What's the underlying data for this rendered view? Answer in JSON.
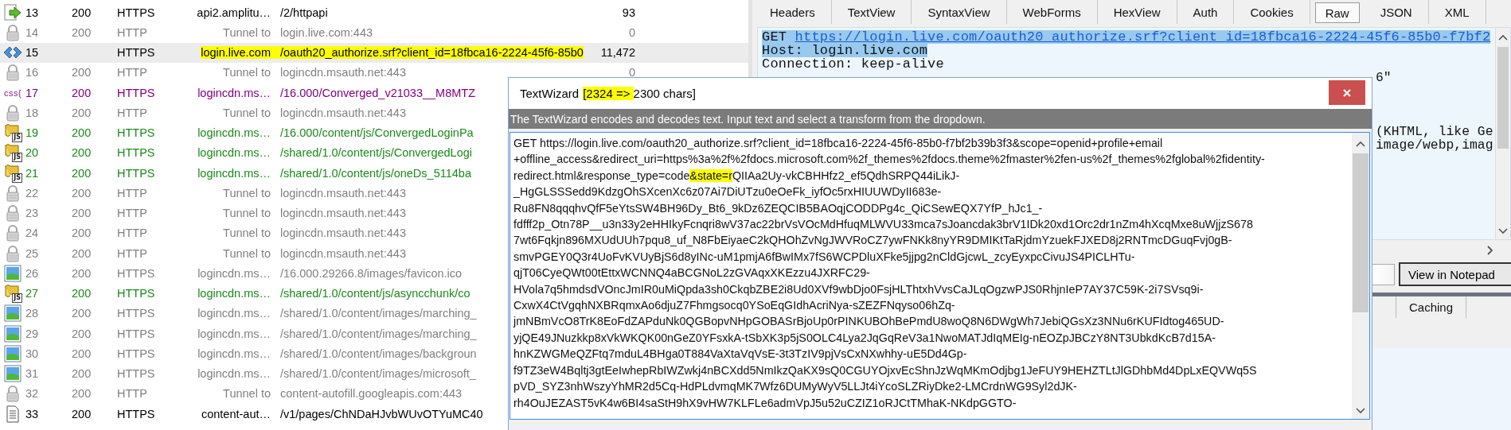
{
  "sessions": {
    "rows": [
      {
        "kind": "arrow",
        "number": "13",
        "result": "200",
        "protocol": "HTTPS",
        "host": "api2.amplitu…",
        "url": "/2/httpapi",
        "body": "93",
        "color": "#000000",
        "selected": false,
        "marked": false
      },
      {
        "kind": "lock",
        "number": "14",
        "result": "200",
        "protocol": "HTTP",
        "host": "Tunnel to",
        "url": "login.live.com:443",
        "body": "0",
        "color": "#808080",
        "selected": false,
        "marked": false
      },
      {
        "kind": "code",
        "number": "15",
        "protocol": "HTTPS",
        "host": "login.live.com",
        "url": "/oauth20_authorize.srf?client_id=18fbca16-2224-45f6-85b0",
        "body": "11,472",
        "color": "#000000",
        "selected": true,
        "marked": true
      },
      {
        "kind": "lock",
        "number": "16",
        "result": "200",
        "protocol": "HTTP",
        "host": "Tunnel to",
        "url": "logincdn.msauth.net:443",
        "body": "0",
        "color": "#808080",
        "selected": false,
        "marked": false
      },
      {
        "kind": "css",
        "icon_text": "css{",
        "number": "17",
        "result": "200",
        "protocol": "HTTPS",
        "host": "logincdn.ms…",
        "url": "/16.000/Converged_v21033__M8MTZ",
        "color": "#800080",
        "selected": false,
        "marked": false
      },
      {
        "kind": "lock",
        "number": "18",
        "result": "200",
        "protocol": "HTTP",
        "host": "Tunnel to",
        "url": "logincdn.msauth.net:443",
        "color": "#808080",
        "selected": false,
        "marked": false
      },
      {
        "kind": "js",
        "icon_text": "JS",
        "number": "19",
        "result": "200",
        "protocol": "HTTPS",
        "host": "logincdn.ms…",
        "url": "/16.000/content/js/ConvergedLoginPa",
        "color": "#1a8a1a",
        "selected": false,
        "marked": false
      },
      {
        "kind": "js",
        "icon_text": "JS",
        "number": "20",
        "result": "200",
        "protocol": "HTTPS",
        "host": "logincdn.ms…",
        "url": "/shared/1.0/content/js/ConvergedLogi",
        "color": "#1a8a1a",
        "selected": false,
        "marked": false
      },
      {
        "kind": "js",
        "icon_text": "JS",
        "number": "21",
        "result": "200",
        "protocol": "HTTPS",
        "host": "logincdn.ms…",
        "url": "/shared/1.0/content/js/oneDs_5114ba",
        "color": "#1a8a1a",
        "selected": false,
        "marked": false
      },
      {
        "kind": "lock",
        "number": "22",
        "result": "200",
        "protocol": "HTTP",
        "host": "Tunnel to",
        "url": "logincdn.msauth.net:443",
        "color": "#808080",
        "selected": false,
        "marked": false
      },
      {
        "kind": "lock",
        "number": "23",
        "result": "200",
        "protocol": "HTTP",
        "host": "Tunnel to",
        "url": "logincdn.msauth.net:443",
        "color": "#808080",
        "selected": false,
        "marked": false
      },
      {
        "kind": "lock",
        "number": "24",
        "result": "200",
        "protocol": "HTTP",
        "host": "Tunnel to",
        "url": "logincdn.msauth.net:443",
        "color": "#808080",
        "selected": false,
        "marked": false
      },
      {
        "kind": "lock",
        "number": "25",
        "result": "200",
        "protocol": "HTTP",
        "host": "Tunnel to",
        "url": "logincdn.msauth.net:443",
        "color": "#808080",
        "selected": false,
        "marked": false
      },
      {
        "kind": "image",
        "number": "26",
        "result": "200",
        "protocol": "HTTPS",
        "host": "logincdn.ms…",
        "url": "/16.000.29266.8/images/favicon.ico",
        "color": "#808080",
        "selected": false,
        "marked": false
      },
      {
        "kind": "js",
        "icon_text": "JS",
        "number": "27",
        "result": "200",
        "protocol": "HTTPS",
        "host": "logincdn.ms…",
        "url": "/shared/1.0/content/js/asyncchunk/co",
        "color": "#1a8a1a",
        "selected": false,
        "marked": false
      },
      {
        "kind": "image",
        "number": "28",
        "result": "200",
        "protocol": "HTTPS",
        "host": "logincdn.ms…",
        "url": "/shared/1.0/content/images/marching_",
        "color": "#808080",
        "selected": false,
        "marked": false
      },
      {
        "kind": "image",
        "number": "29",
        "result": "200",
        "protocol": "HTTPS",
        "host": "logincdn.ms…",
        "url": "/shared/1.0/content/images/marching_",
        "color": "#808080",
        "selected": false,
        "marked": false
      },
      {
        "kind": "image",
        "number": "30",
        "result": "200",
        "protocol": "HTTPS",
        "host": "logincdn.ms…",
        "url": "/shared/1.0/content/images/backgroun",
        "color": "#808080",
        "selected": false,
        "marked": false
      },
      {
        "kind": "image",
        "number": "31",
        "result": "200",
        "protocol": "HTTPS",
        "host": "logincdn.ms…",
        "url": "/shared/1.0/content/images/microsoft_",
        "color": "#808080",
        "selected": false,
        "marked": false
      },
      {
        "kind": "lock",
        "number": "32",
        "result": "200",
        "protocol": "HTTP",
        "host": "Tunnel to",
        "url": "content-autofill.googleapis.com:443",
        "color": "#808080",
        "selected": false,
        "marked": false
      },
      {
        "kind": "doc",
        "number": "33",
        "result": "200",
        "protocol": "HTTPS",
        "host": "content-aut…",
        "url": "/v1/pages/ChNDaHJvbWUvOTYuMC40",
        "color": "#000000",
        "selected": false,
        "marked": false
      }
    ]
  },
  "inspector": {
    "tabs": [
      {
        "label": "Headers",
        "selected": false
      },
      {
        "label": "TextView",
        "selected": false
      },
      {
        "label": "SyntaxView",
        "selected": false
      },
      {
        "label": "WebForms",
        "selected": false
      },
      {
        "label": "HexView",
        "selected": false
      },
      {
        "label": "Auth",
        "selected": false
      },
      {
        "label": "Cookies",
        "selected": false
      },
      {
        "label": "Raw",
        "selected": true
      },
      {
        "label": "JSON",
        "selected": false
      },
      {
        "label": "XML",
        "selected": false
      }
    ],
    "raw": {
      "lines": [
        {
          "text": "GET",
          "link": "https://login.live.com/oauth20_authorize.srf?client_id=18fbca16-2224-45f6-85b0-f7bf2",
          "selected": true
        },
        {
          "text": "Host: login.live.com",
          "selected": true
        },
        {
          "text": "Connection: keep-alive",
          "selected": false
        }
      ],
      "tails": [
        "6\"",
        "(KHTML, like Ge",
        "image/webp,imag"
      ]
    },
    "notepad_button": "View in Notepad",
    "lower_tabs": [
      {
        "label": "Caching",
        "selected": false
      }
    ]
  },
  "text_wizard": {
    "title": "TextWizard",
    "count": "[2324 => 2300 chars]",
    "description": "The TextWizard encodes and decodes text. Input text and select a transform from the dropdown.",
    "lines": [
      [
        {
          "text": "GET https://login.live.com/oauth20_authorize.srf?client_id=18fbca16-2224-45f6-85b0-f7bf2b39b3f3&scope=openid+profile+email",
          "highlighted": false
        }
      ],
      [
        {
          "text": "+offline_access&redirect_uri=https%3a%2f%2fdocs.microsoft.com%2f_themes%2fdocs.theme%2fmaster%2fen-us%2f_themes%2fglobal%2fidentity-",
          "highlighted": false
        }
      ],
      [
        {
          "text": "redirect.html&response_type=code",
          "highlighted": false
        },
        {
          "text": "&state=r",
          "highlighted": true
        },
        {
          "text": "QIIAa2Uy-vkCBHHfz2_ef5QdhSRPQ44iLikJ-",
          "highlighted": false
        }
      ],
      [
        {
          "text": "_HgGLSSSedd9KdzgOhSXcenXc6z07Ai7DiUTzu0eOeFk_iyfOc5rxHIUUWDyII683e-",
          "highlighted": false
        }
      ],
      [
        {
          "text": "Ru8FN8qqqhvQfF5eYtsSW4BH96Dy_Bt6_9kDz6ZEQCIB5BAOqjCODDPg4c_QiCSewEQX7YfP_hJc1_-",
          "highlighted": false
        }
      ],
      [
        {
          "text": "fdfff2p_Otn78P__u3n33y2eHHIkyFcnqri8wV37ac22brVsVOcMdHfuqMLWVU33mca7sJoancdak3brV1IDk20xd1Orc2dr1nZm4hXcqMxe8uWjjzS678",
          "highlighted": false
        }
      ],
      [
        {
          "text": "7wt6Fqkjn896MXUdUUh7pqu8_uf_N8FbEiyaeC2kQHOhZvNgJWVRoCZ7ywFNKk8nyYR9DMIKtTaRjdmYzuekFJXED8j2RNTmcDGuqFvj0gB-",
          "highlighted": false
        }
      ],
      [
        {
          "text": "smvPGEY0Q3r4UoFvKVUyBjS6d8yINc-uM1pmjA6fBwIMx7fS6WCPDluXFke5jjpg2nCldGjcwL_zcyEyxpcCivuJS4PICLHTu-",
          "highlighted": false
        }
      ],
      [
        {
          "text": "qjT06CyeQWt00tEttxWCNNQ4aBCGNoL2zGVAqxXKEzzu4JXRFC29-",
          "highlighted": false
        }
      ],
      [
        {
          "text": "HVola7q5hmdsdVOncJmIR0uMiQpda3sh0CkqbZBE2i8Ud0XVf9wbDjo0FsjHLThtxhVvsCaJLqOgzwPJS0RhjnIeP7AY37C59K-2i7SVsq9i-",
          "highlighted": false
        }
      ],
      [
        {
          "text": "CxwX4CtVgqhNXBRqmxAo6djuZ7Fhmgsocq0YSoEqGIdhAcriNya-sZEZFNqyso06hZq-",
          "highlighted": false
        }
      ],
      [
        {
          "text": "jmNBmVcO8TrK8EoFdZAPduNk0QGBopvNHpGOBASrBjoUp0rPINKUBOhBePmdU8woQ8N6DWgWh7JebiQGsXz3NNu6rKUFIdtog465UD-",
          "highlighted": false
        }
      ],
      [
        {
          "text": "yjQE49JNuzkkp8xVkWKQK00nGeZ0YFsxkA-tSbXK3p5jS0OLC4Lya2JqGqReV3a1NwoMATJdIqMEIg-nEOZpJBCzY8NT3UbkdKcB7d15A-",
          "highlighted": false
        }
      ],
      [
        {
          "text": "hnKZWGMeQZFtq7mduL4BHga0T884VaXtaVqVsE-3t3TzIV9pjVsCxNXwhhy-uE5Dd4Gp-",
          "highlighted": false
        }
      ],
      [
        {
          "text": "f9TZ3eW4Bqltj3gtEeIwhepRbIWZwkj4nBCXdd5NmIkzQaKX9sQ0CGUYOjxvEcShnJzWqMKmOdjbg1JeFUY9HEHZTLtJlGDhbMd4DpLxEQVWq5S",
          "highlighted": false
        }
      ],
      [
        {
          "text": "pVD_SYZ3nhWszyYhMR2d5Cq-HdPLdvmqMK7Wfz6DUMyWyV5LLJt4iYcoSLZRiyDke2-LMCrdnWG9Syl2dJK-",
          "highlighted": false
        }
      ],
      [
        {
          "text": "rh4OuJEZAST5vK4w6BI4saStH9hX9vHW7KLFLe6admVpJ5u52uCZIZ1oRJCtTMhaK-NKdpGGTO-",
          "highlighted": false
        }
      ]
    ]
  }
}
